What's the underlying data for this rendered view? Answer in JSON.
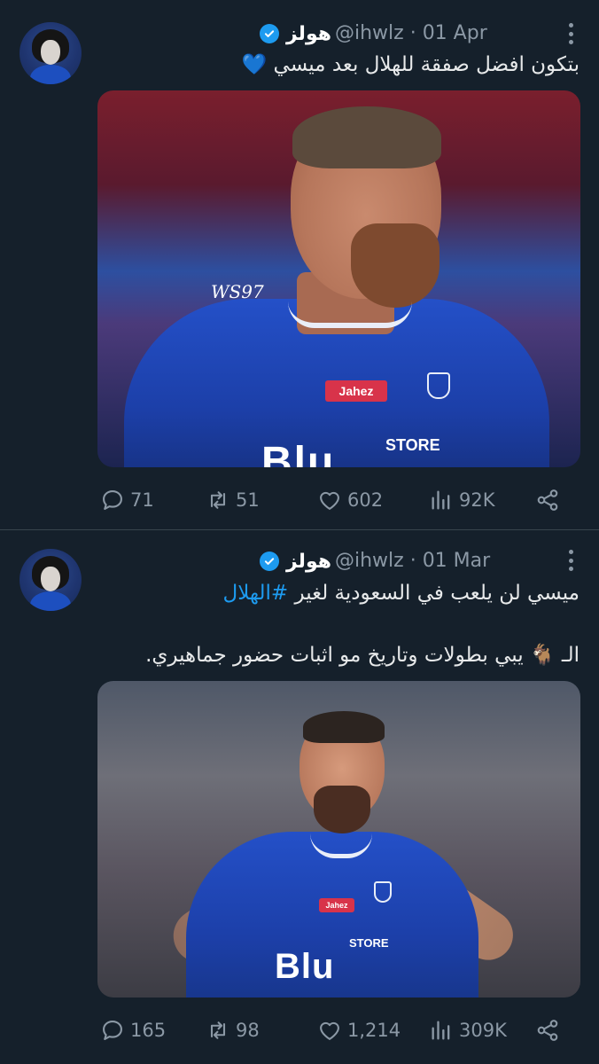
{
  "tweets": [
    {
      "name": "هولز",
      "handle_date": "@ihwlz · 01 Apr",
      "text": "بتكون افضل صفقة للهلال بعد ميسي 💙",
      "media": {
        "watermark": "WS97",
        "sponsor": "Jahez",
        "store": "STORE",
        "shirt": "Blu"
      },
      "stats": {
        "replies": "71",
        "retweets": "51",
        "likes": "602",
        "views": "92K"
      }
    },
    {
      "name": "هولز",
      "handle_date": "@ihwlz · 01 Mar",
      "text_plain": "ميسي لن يلعب في السعودية لغير ",
      "hashtag": "#الهلال",
      "text_line2": "الـ 🐐 يبي بطولات وتاريخ مو اثبات حضور جماهيري.",
      "media": {
        "sponsor": "Jahez",
        "store": "STORE",
        "shirt": "Blu"
      },
      "stats": {
        "replies": "165",
        "retweets": "98",
        "likes": "1,214",
        "views": "309K"
      }
    }
  ],
  "icons": {
    "verified": "verified-badge-icon",
    "more": "more-options-icon",
    "reply": "reply-icon",
    "retweet": "retweet-icon",
    "like": "like-icon",
    "views": "views-icon",
    "share": "share-icon"
  },
  "colors": {
    "background": "#15202b",
    "text": "#e7e9ea",
    "muted": "#8b98a5",
    "accent": "#1d9bf0",
    "divider": "#38444d"
  }
}
